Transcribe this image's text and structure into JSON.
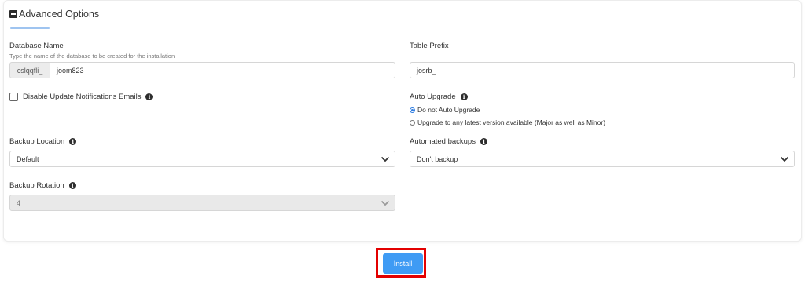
{
  "section": {
    "title": "Advanced Options",
    "icon": "minus-square-icon",
    "accent_color": "#9fc4f0"
  },
  "database": {
    "label": "Database Name",
    "hint": "Type the name of the database to be created for the installation",
    "prefix": "cslqqfli_",
    "value": "joom823"
  },
  "table_prefix": {
    "label": "Table Prefix",
    "value": "josrb_"
  },
  "disable_notifications": {
    "label": "Disable Update Notifications Emails",
    "checked": false
  },
  "auto_upgrade": {
    "label": "Auto Upgrade",
    "options": [
      {
        "label": "Do not Auto Upgrade",
        "selected": true
      },
      {
        "label": "Upgrade to any latest version available (Major as well as Minor)",
        "selected": false
      }
    ]
  },
  "backup_location": {
    "label": "Backup Location",
    "value": "Default"
  },
  "automated_backups": {
    "label": "Automated backups",
    "value": "Don't backup"
  },
  "backup_rotation": {
    "label": "Backup Rotation",
    "value": "4",
    "disabled": true
  },
  "install": {
    "label": "Install",
    "color": "#3f9bf4",
    "highlight_color": "#e30000"
  }
}
